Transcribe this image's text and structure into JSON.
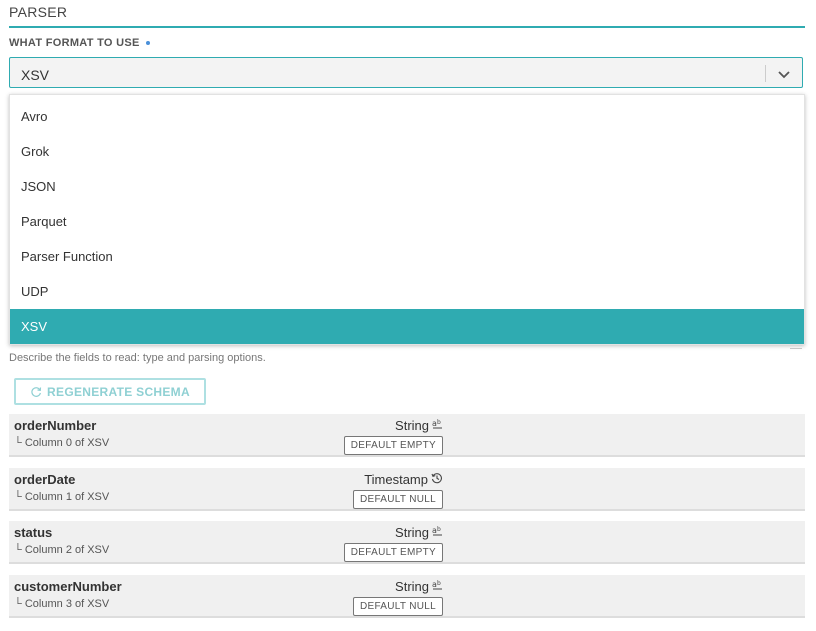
{
  "parser": {
    "section_title": "PARSER",
    "format_label": "WHAT FORMAT TO USE",
    "selected_format": "XSV",
    "options": [
      {
        "label": "Avro",
        "selected": false
      },
      {
        "label": "Grok",
        "selected": false
      },
      {
        "label": "JSON",
        "selected": false
      },
      {
        "label": "Parquet",
        "selected": false
      },
      {
        "label": "Parser Function",
        "selected": false
      },
      {
        "label": "UDP",
        "selected": false
      },
      {
        "label": "XSV",
        "selected": true
      }
    ]
  },
  "schema": {
    "description": "Describe the fields to read: type and parsing options.",
    "regenerate_label": "REGENERATE SCHEMA",
    "fields": [
      {
        "name": "orderNumber",
        "source": "Column 0 of XSV",
        "type": "String",
        "type_icon": "text-type-icon",
        "default": "DEFAULT EMPTY"
      },
      {
        "name": "orderDate",
        "source": "Column 1 of XSV",
        "type": "Timestamp",
        "type_icon": "clock-history-icon",
        "default": "DEFAULT NULL"
      },
      {
        "name": "status",
        "source": "Column 2 of XSV",
        "type": "String",
        "type_icon": "text-type-icon",
        "default": "DEFAULT EMPTY"
      },
      {
        "name": "customerNumber",
        "source": "Column 3 of XSV",
        "type": "String",
        "type_icon": "text-type-icon",
        "default": "DEFAULT NULL"
      }
    ]
  },
  "colors": {
    "accent": "#2fabb1",
    "row_bg": "#f0f0f0"
  }
}
